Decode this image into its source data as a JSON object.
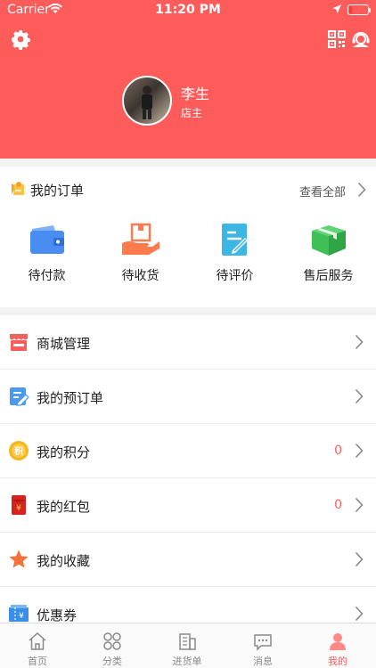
{
  "status_bar": {
    "carrier": "Carrier",
    "time": "11:20 PM"
  },
  "header": {
    "user_name": "李生",
    "user_role": "店主",
    "icons": [
      "gear-icon",
      "qr-code-icon",
      "customer-service-icon"
    ]
  },
  "orders": {
    "title": "我的订单",
    "view_all": "查看全部",
    "items": [
      {
        "label": "待付款",
        "icon": "wallet-icon",
        "color": "#4a8df2"
      },
      {
        "label": "待收货",
        "icon": "receive-icon",
        "color": "#ff7a4d"
      },
      {
        "label": "待评价",
        "icon": "review-icon",
        "color": "#3cb6e3"
      },
      {
        "label": "售后服务",
        "icon": "package-icon",
        "color": "#3fbf56"
      }
    ]
  },
  "menu": [
    {
      "label": "商城管理",
      "icon": "store-icon",
      "value": ""
    },
    {
      "label": "我的预订单",
      "icon": "preorder-icon",
      "value": ""
    },
    {
      "label": "我的积分",
      "icon": "points-icon",
      "value": "0"
    },
    {
      "label": "我的红包",
      "icon": "red-packet-icon",
      "value": "0"
    },
    {
      "label": "我的收藏",
      "icon": "star-icon",
      "value": ""
    },
    {
      "label": "优惠券",
      "icon": "coupon-icon",
      "value": ""
    }
  ],
  "tabbar": [
    {
      "label": "首页",
      "icon": "home-icon",
      "active": false
    },
    {
      "label": "分类",
      "icon": "category-icon",
      "active": false
    },
    {
      "label": "进货单",
      "icon": "purchase-list-icon",
      "active": false
    },
    {
      "label": "消息",
      "icon": "message-icon",
      "active": false
    },
    {
      "label": "我的",
      "icon": "profile-icon",
      "active": true
    }
  ],
  "colors": {
    "brand": "#fe5c5a",
    "tab_inactive": "#8a8a8a"
  }
}
